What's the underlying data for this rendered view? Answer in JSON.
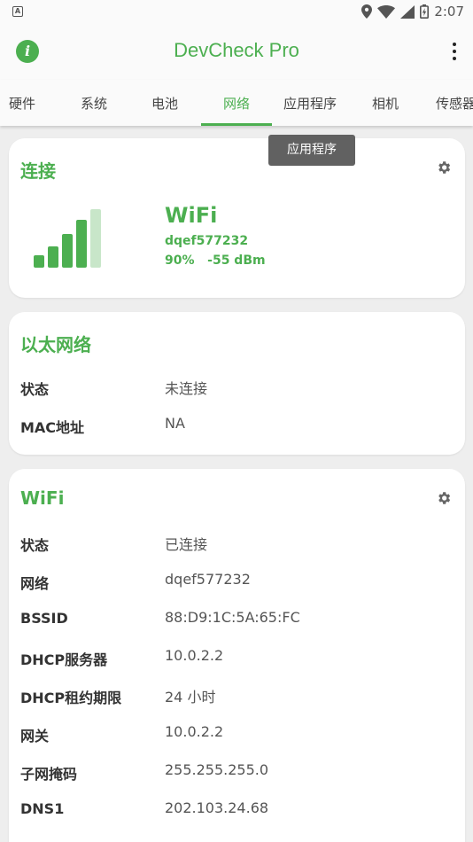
{
  "statusbar": {
    "time": "2:07",
    "notification_icon": "A"
  },
  "appbar": {
    "title": "DevCheck Pro"
  },
  "tabs": [
    "硬件",
    "系统",
    "电池",
    "网络",
    "应用程序",
    "相机",
    "传感器"
  ],
  "active_tab": "网络",
  "tooltip": "应用程序",
  "connection": {
    "title": "连接",
    "type": "WiFi",
    "ssid": "dqef577232",
    "strength": "90%",
    "dbm": "-55 dBm"
  },
  "ethernet": {
    "title": "以太网络",
    "rows": [
      {
        "label": "状态",
        "value": "未连接"
      },
      {
        "label": "MAC地址",
        "value": "NA"
      }
    ]
  },
  "wifi": {
    "title": "WiFi",
    "rows": [
      {
        "label": "状态",
        "value": "已连接"
      },
      {
        "label": "网络",
        "value": "dqef577232"
      },
      {
        "label": "BSSID",
        "value": "88:D9:1C:5A:65:FC"
      },
      {
        "label": "DHCP服务器",
        "value": "10.0.2.2"
      },
      {
        "label": "DHCP租约期限",
        "value": "24 小时"
      },
      {
        "label": "网关",
        "value": "10.0.2.2"
      },
      {
        "label": "子网掩码",
        "value": "255.255.255.0"
      },
      {
        "label": "DNS1",
        "value": "202.103.24.68"
      }
    ]
  },
  "colors": {
    "accent": "#4caf50",
    "accent_light": "#c8e6c9",
    "tooltip_bg": "#616161"
  },
  "icons": [
    "info-icon",
    "more-vert-icon",
    "gear-icon",
    "location-icon",
    "wifi-icon",
    "cell-signal-icon",
    "battery-icon"
  ]
}
